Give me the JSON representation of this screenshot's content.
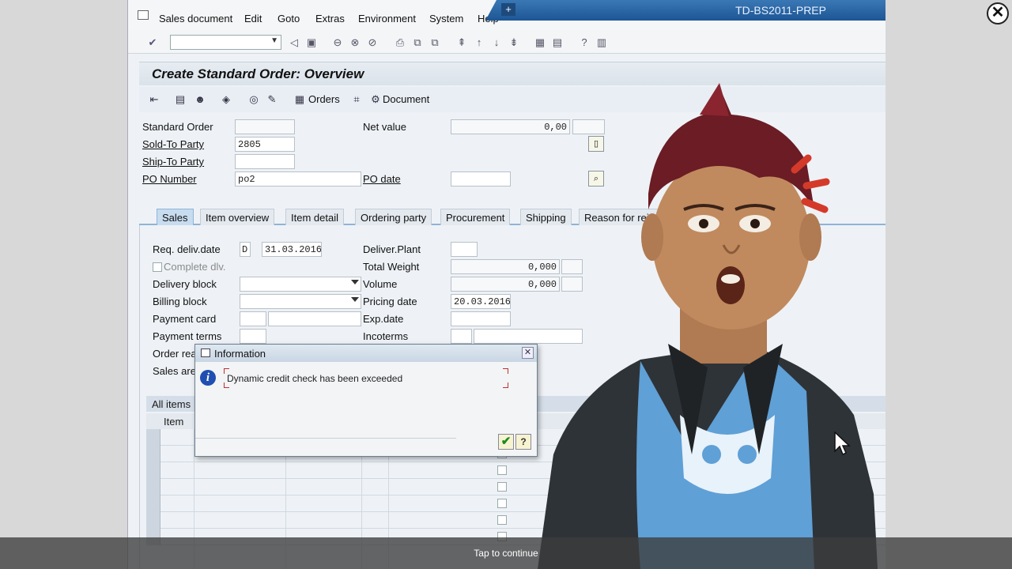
{
  "window": {
    "title": "TD-BS2011-PREP"
  },
  "menu": {
    "items": [
      "Sales document",
      "Edit",
      "Goto",
      "Extras",
      "Environment",
      "System",
      "Help"
    ]
  },
  "screen": {
    "title": "Create Standard Order: Overview"
  },
  "app_toolbar": {
    "orders_label": "Orders",
    "document_label": "Document"
  },
  "header_fields": {
    "standard_order": {
      "label": "Standard Order",
      "value": ""
    },
    "sold_to_party": {
      "label": "Sold-To Party",
      "value": "2805"
    },
    "ship_to_party": {
      "label": "Ship-To Party",
      "value": ""
    },
    "po_number": {
      "label": "PO Number",
      "value": "po2"
    },
    "net_value": {
      "label": "Net value",
      "value": "0,00",
      "currency": ""
    },
    "po_date": {
      "label": "PO date",
      "value": ""
    }
  },
  "tabs": [
    "Sales",
    "Item overview",
    "Item detail",
    "Ordering party",
    "Procurement",
    "Shipping",
    "Reason for rej"
  ],
  "sales_tab": {
    "req_deliv_date": {
      "label": "Req. deliv.date",
      "period": "D",
      "value": "31.03.2016"
    },
    "complete_dlv": {
      "label": "Complete dlv."
    },
    "delivery_block": {
      "label": "Delivery block",
      "value": ""
    },
    "billing_block": {
      "label": "Billing block",
      "value": ""
    },
    "payment_card": {
      "label": "Payment card",
      "value": ""
    },
    "payment_terms": {
      "label": "Payment terms",
      "value": ""
    },
    "order_reason": {
      "label": "Order rea"
    },
    "sales_area": {
      "label": "Sales area"
    },
    "deliver_plant": {
      "label": "Deliver.Plant",
      "value": ""
    },
    "total_weight": {
      "label": "Total Weight",
      "value": "0,000"
    },
    "volume": {
      "label": "Volume",
      "value": "0,000"
    },
    "pricing_date": {
      "label": "Pricing date",
      "value": "20.03.2016"
    },
    "exp_date": {
      "label": "Exp.date",
      "value": ""
    },
    "incoterms": {
      "label": "Incoterms",
      "value": ""
    }
  },
  "items_grid": {
    "header": "All items",
    "columns": [
      "Item"
    ]
  },
  "dialog": {
    "title": "Information",
    "message": "Dynamic credit check has been exceeded"
  },
  "overlay": {
    "continue_text": "Tap to continue"
  },
  "colors": {
    "title_blue": "#1d5694",
    "accent": "#c7dcef"
  }
}
